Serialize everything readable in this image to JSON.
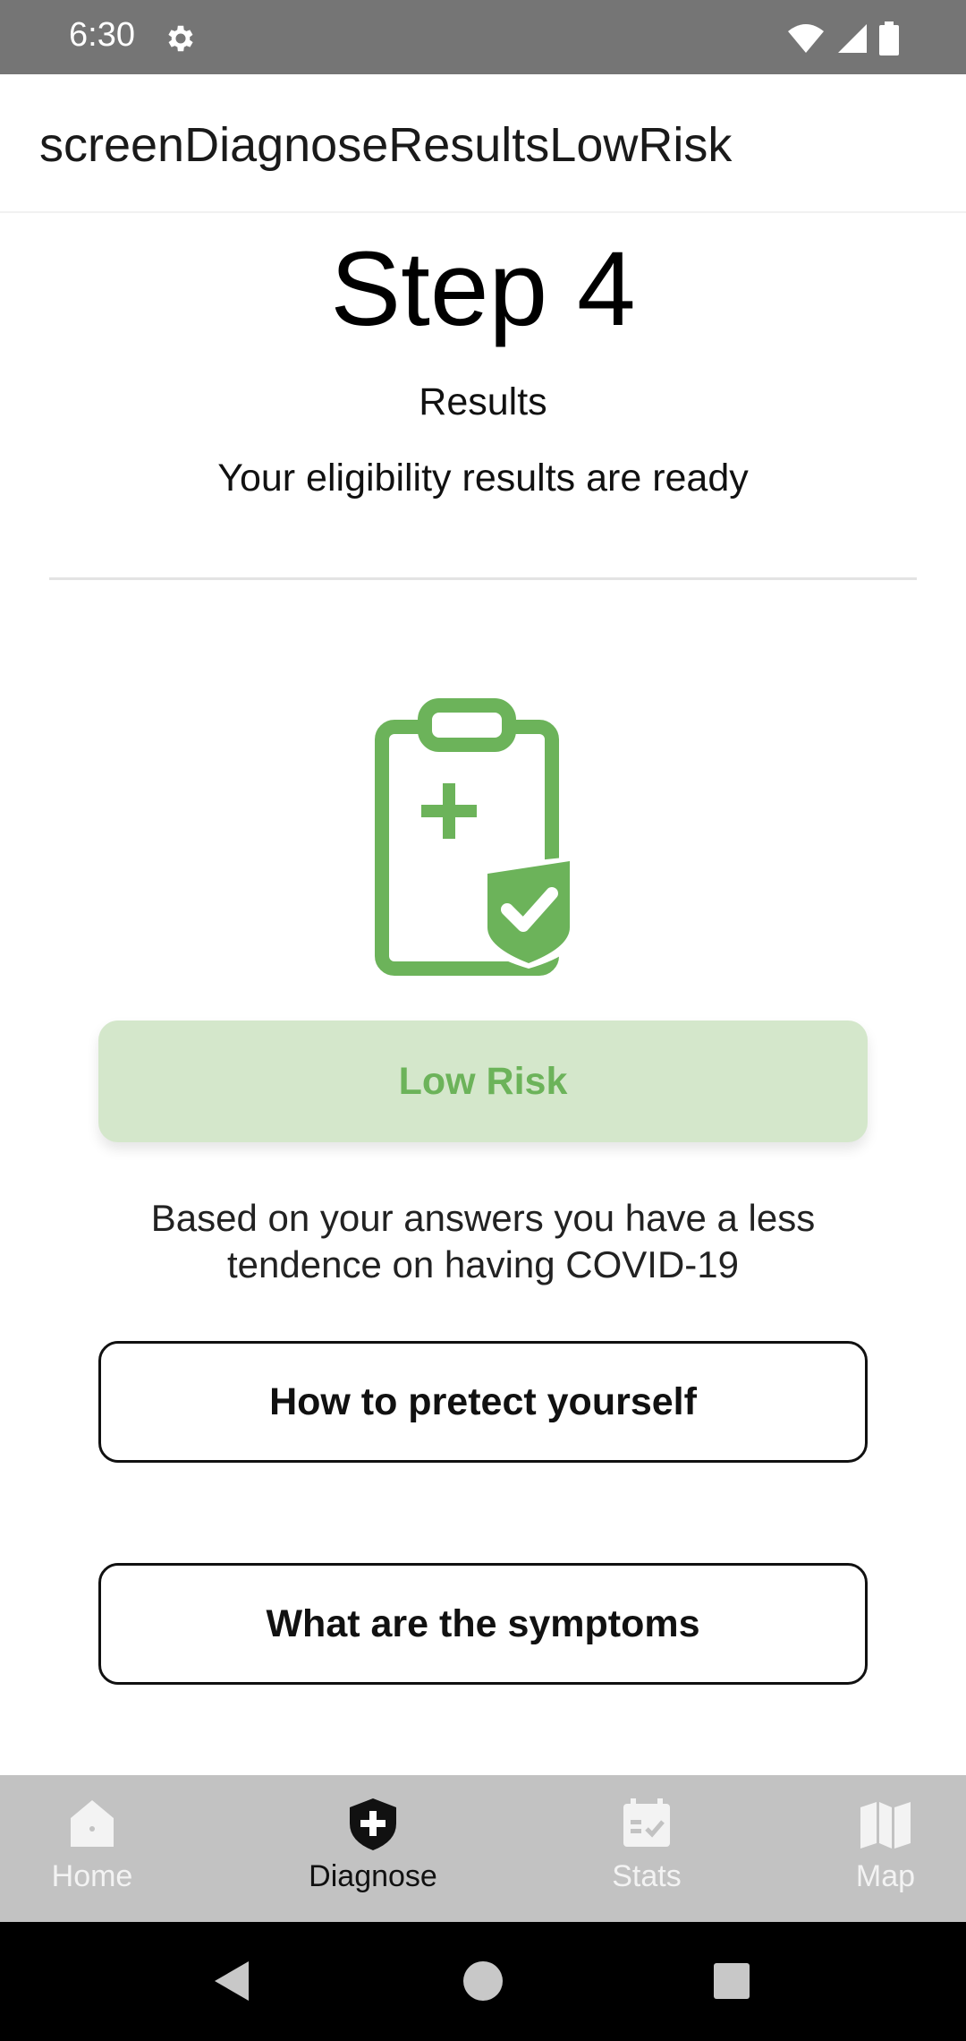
{
  "status_bar": {
    "time": "6:30"
  },
  "app_bar": {
    "title": "screenDiagnoseResultsLowRisk"
  },
  "content": {
    "step_title": "Step 4",
    "results_label": "Results",
    "eligibility_text": "Your eligibility results are ready",
    "risk_label": "Low Risk",
    "advice_text": "Based on your answers you have a less tendence on having COVID-19",
    "protect_button": "How to pretect yourself",
    "symptoms_button": "What are the symptoms"
  },
  "bottom_nav": {
    "items": [
      {
        "label": "Home",
        "icon": "home-icon",
        "active": false
      },
      {
        "label": "Diagnose",
        "icon": "shield-plus-icon",
        "active": true
      },
      {
        "label": "Stats",
        "icon": "calendar-check-icon",
        "active": false
      },
      {
        "label": "Map",
        "icon": "map-icon",
        "active": false
      }
    ]
  },
  "colors": {
    "accent_green": "#6cb35a",
    "risk_pill_bg": "#d4e7cb",
    "status_bar": "#757575",
    "bottom_nav_bg": "#c2c2c2"
  }
}
